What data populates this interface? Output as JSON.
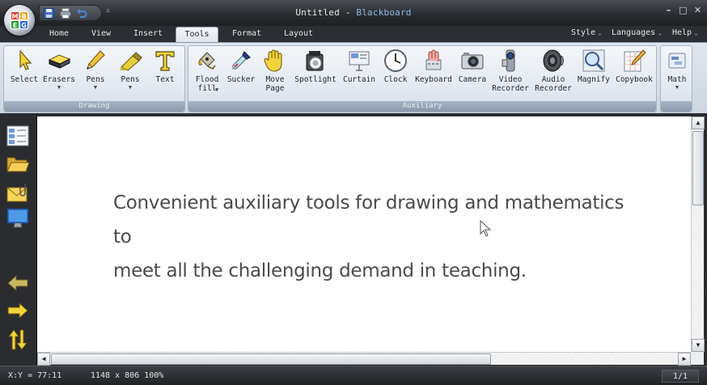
{
  "window": {
    "title_doc": "Untitled",
    "title_sep": " - ",
    "title_app": "Blackboard",
    "controls": [
      "–",
      "□",
      "✕"
    ]
  },
  "orb": {
    "letters": [
      "M",
      "B",
      "E",
      "G"
    ]
  },
  "quick_access": {
    "more": "⩡"
  },
  "tabs": [
    {
      "label": "Home",
      "active": false
    },
    {
      "label": "View",
      "active": false
    },
    {
      "label": "Insert",
      "active": false
    },
    {
      "label": "Tools",
      "active": true
    },
    {
      "label": "Format",
      "active": false
    },
    {
      "label": "Layout",
      "active": false
    }
  ],
  "right_menus": [
    {
      "label": "Style"
    },
    {
      "label": "Languages"
    },
    {
      "label": "Help"
    }
  ],
  "ribbon": {
    "groups": [
      {
        "label": "Drawing",
        "tools": [
          {
            "label": "Select",
            "icon": "arrow-cursor-icon",
            "dropdown": false
          },
          {
            "label": "Erasers",
            "icon": "eraser-icon",
            "dropdown": true
          },
          {
            "label": "Pens",
            "icon": "pencil-icon",
            "dropdown": true
          },
          {
            "label": "Pens",
            "icon": "highlighter-icon",
            "dropdown": true
          },
          {
            "label": "Text",
            "icon": "text-t-icon",
            "dropdown": false
          }
        ]
      },
      {
        "label": "Auxiliary",
        "tools": [
          {
            "label": "Flood\nfill",
            "icon": "paint-bucket-icon",
            "dropdown": true
          },
          {
            "label": "Sucker",
            "icon": "eyedropper-icon",
            "dropdown": false
          },
          {
            "label": "Move\nPage",
            "icon": "hand-icon",
            "dropdown": false
          },
          {
            "label": "Spotlight",
            "icon": "spotlight-icon",
            "dropdown": false
          },
          {
            "label": "Curtain",
            "icon": "curtain-icon",
            "dropdown": false
          },
          {
            "label": "Clock",
            "icon": "clock-icon",
            "dropdown": false
          },
          {
            "label": "Keyboard",
            "icon": "keyboard-icon",
            "dropdown": false
          },
          {
            "label": "Camera",
            "icon": "camera-icon",
            "dropdown": false
          },
          {
            "label": "Video\nRecorder",
            "icon": "video-recorder-icon",
            "dropdown": false
          },
          {
            "label": "Audio\nRecorder",
            "icon": "speaker-icon",
            "dropdown": false
          },
          {
            "label": "Magnify",
            "icon": "magnifier-icon",
            "dropdown": false
          },
          {
            "label": "Copybook",
            "icon": "copybook-icon",
            "dropdown": false
          }
        ]
      },
      {
        "label": "",
        "tools": [
          {
            "label": "Math",
            "icon": "math-icon",
            "dropdown": true
          }
        ]
      }
    ]
  },
  "left_toolbar": [
    {
      "icon": "page-list-icon"
    },
    {
      "icon": "open-folder-icon"
    },
    {
      "icon": "mail-attachment-icon"
    },
    {
      "icon": "monitor-icon"
    },
    {
      "icon": "back-arrow-icon"
    },
    {
      "icon": "forward-arrow-icon"
    },
    {
      "icon": "swap-arrows-icon"
    }
  ],
  "document": {
    "lines": [
      "Convenient auxiliary tools for drawing and mathematics to",
      "meet all the challenging demand in teaching."
    ]
  },
  "scrollbars": {
    "vertical_position": 0.0,
    "horizontal_position": 0.0
  },
  "status": {
    "coord": "X:Y = 77:11",
    "size": "1148 x 806 100%",
    "page": "1/1"
  },
  "colors": {
    "chrome_dark": "#2a2d31",
    "ribbon_bg": "#dfe6ee",
    "group_label_bg": "#8a99ab",
    "title_app": "#8fb8ea",
    "doc_text": "#4a4a4a"
  }
}
